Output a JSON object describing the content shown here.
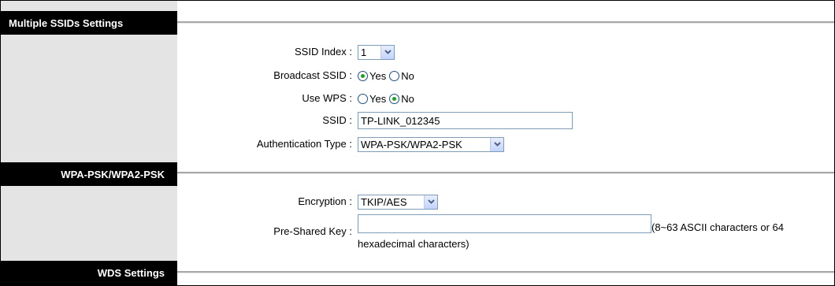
{
  "sections": {
    "multiple_ssids": "Multiple SSIDs Settings",
    "wpa": "WPA-PSK/WPA2-PSK",
    "wds": "WDS Settings"
  },
  "fields": {
    "ssid_index": {
      "label": "SSID Index :",
      "value": "1"
    },
    "broadcast_ssid": {
      "label": "Broadcast SSID :",
      "yes": "Yes",
      "no": "No",
      "selected": "Yes"
    },
    "use_wps": {
      "label": "Use WPS :",
      "yes": "Yes",
      "no": "No",
      "selected": "No"
    },
    "ssid": {
      "label": "SSID :",
      "value": "TP-LINK_012345"
    },
    "auth_type": {
      "label": "Authentication Type :",
      "value": "WPA-PSK/WPA2-PSK"
    },
    "encryption": {
      "label": "Encryption :",
      "value": "TKIP/AES"
    },
    "psk": {
      "label": "Pre-Shared Key :",
      "value": "",
      "hint_line1": "(8~63 ASCII characters or 64",
      "hint_line2": "hexadecimal characters)"
    }
  },
  "icons": {
    "dropdown": "chevron-down-icon",
    "radio_on": "radio-selected-icon",
    "radio_off": "radio-empty-icon"
  },
  "colors": {
    "header_bg": "#000000",
    "sidebar_bg": "#e4e4e4",
    "radio_dot": "#21a121",
    "input_border": "#7f9db9"
  }
}
